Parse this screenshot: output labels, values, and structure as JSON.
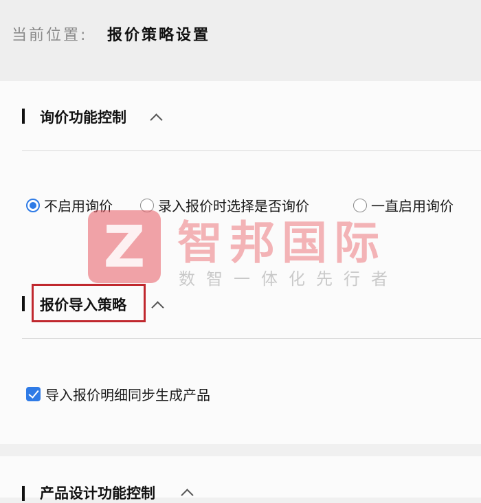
{
  "breadcrumb": {
    "label": "当前位置:",
    "current": "报价策略设置"
  },
  "sections": {
    "inquiry": {
      "title": "询价功能控制",
      "options": [
        {
          "label": "不启用询价",
          "selected": true
        },
        {
          "label": "录入报价时选择是否询价",
          "selected": false
        },
        {
          "label": "一直启用询价",
          "selected": false
        }
      ]
    },
    "import": {
      "title": "报价导入策略",
      "checkbox_label": "导入报价明细同步生成产品",
      "checkbox_checked": true
    },
    "product_design": {
      "title": "产品设计功能控制"
    }
  },
  "watermark": {
    "logo_letter": "Z",
    "title": "智邦国际",
    "subtitle": "数智一体化先行者"
  },
  "colors": {
    "accent": "#2f7be6",
    "highlight": "#c0282e"
  }
}
